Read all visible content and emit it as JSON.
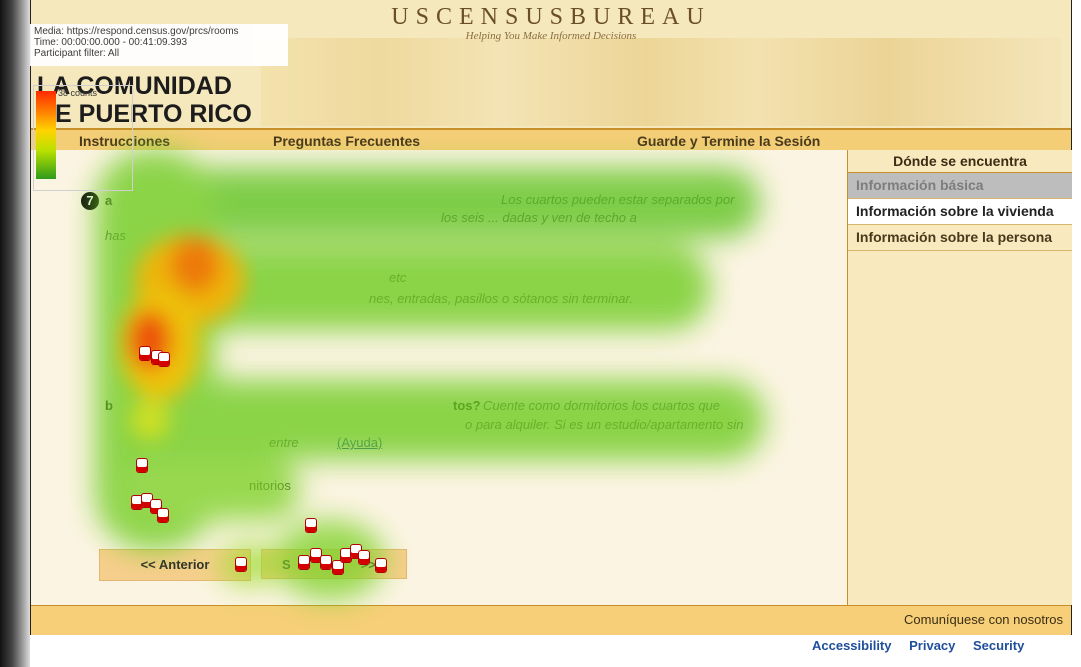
{
  "overlay": {
    "media": "Media: https://respond.census.gov/prcs/rooms",
    "time": "Time: 00:00:00.000 - 00:41:09.393",
    "filter": "Participant filter: All",
    "counts": "38 counts"
  },
  "header": {
    "brand": "USCENSUSBUREAU",
    "tagline": "Helping You Make Informed Decisions",
    "region_line1": "LA COMUNIDAD",
    "region_line2": "DE PUERTO RICO"
  },
  "nav": {
    "instructions": "Instrucciones",
    "faq": "Preguntas Frecuentes",
    "save_exit": "Guarde y Termine la Sesión"
  },
  "question": {
    "number": "7",
    "a_prefix": "a",
    "a_text": "Los cuartos pueden estar separados por",
    "a_text2": "los seis ... dadas y ven de techo a",
    "a_text3": "has",
    "exclude": "nes, entradas, pasillos o sótanos sin terminar.",
    "frag_etc": "etc",
    "b_prefix": "b",
    "b_bold": "tos?",
    "b_text": "Cuente como dormitorios los cuartos que",
    "b_text2": "o para alquiler. Si es un estudio/apartamento sin",
    "b_text3": "entre",
    "help_link": "(Ayuda)",
    "dorm_label": "nitorios"
  },
  "buttons": {
    "prev": "<<  Anterior",
    "next": "S",
    "next_tail": ">>"
  },
  "sidebar": {
    "title": "Dónde se encuentra",
    "items": [
      {
        "label": "Información básica",
        "state": "inactive"
      },
      {
        "label": "Información sobre la vivienda",
        "state": "active"
      },
      {
        "label": "Información sobre la persona",
        "state": "normal"
      }
    ]
  },
  "footer": {
    "contact": "Comuníquese con nosotros",
    "links": [
      "Accessibility",
      "Privacy",
      "Security"
    ]
  },
  "colors": {
    "accent": "#f3ce77",
    "brand": "#6a4e2a",
    "link": "#1f4e9c"
  }
}
